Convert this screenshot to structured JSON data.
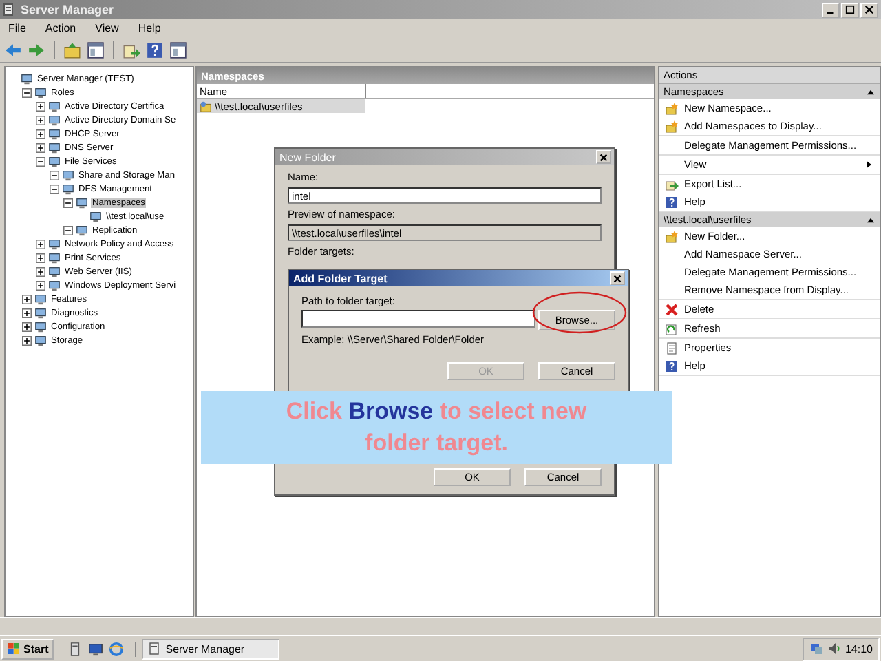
{
  "window": {
    "title": "Server Manager"
  },
  "menu": [
    "File",
    "Action",
    "View",
    "Help"
  ],
  "toolbar": [
    {
      "kind": "back"
    },
    {
      "kind": "forward"
    },
    {
      "kind": "up"
    },
    {
      "kind": "pane"
    },
    {
      "kind": "export"
    },
    {
      "kind": "help"
    },
    {
      "kind": "pane"
    }
  ],
  "tree": [
    {
      "label": "Server Manager (TEST)",
      "selected": false,
      "children": [
        {
          "label": "Roles",
          "selected": false,
          "expanded": true,
          "children": [
            {
              "label": "Active Directory Certifica",
              "selected": false,
              "expanded": false
            },
            {
              "label": "Active Directory Domain Se",
              "selected": false,
              "expanded": false
            },
            {
              "label": "DHCP Server",
              "selected": false,
              "expanded": false
            },
            {
              "label": "DNS Server",
              "selected": false,
              "expanded": false
            },
            {
              "label": "File Services",
              "selected": false,
              "expanded": true,
              "children": [
                {
                  "label": "Share and Storage Man",
                  "selected": false,
                  "expanded": true
                },
                {
                  "label": "DFS Management",
                  "selected": false,
                  "expanded": true,
                  "children": [
                    {
                      "label": "Namespaces",
                      "selected": true,
                      "expanded": true,
                      "children": [
                        {
                          "label": "\\\\test.local\\use",
                          "selected": false
                        }
                      ]
                    },
                    {
                      "label": "Replication",
                      "selected": false,
                      "expanded": true
                    }
                  ]
                }
              ]
            },
            {
              "label": "Network Policy and Access",
              "selected": false,
              "expanded": false
            },
            {
              "label": "Print Services",
              "selected": false,
              "expanded": false
            },
            {
              "label": "Web Server (IIS)",
              "selected": false,
              "expanded": false
            },
            {
              "label": "Windows Deployment Servi",
              "selected": false,
              "expanded": false
            }
          ]
        },
        {
          "label": "Features",
          "selected": false,
          "expanded": false
        },
        {
          "label": "Diagnostics",
          "selected": false,
          "expanded": false
        },
        {
          "label": "Configuration",
          "selected": false,
          "expanded": false
        },
        {
          "label": "Storage",
          "selected": false,
          "expanded": false
        }
      ]
    }
  ],
  "list": {
    "title": "Namespaces",
    "columns": [
      "Name"
    ],
    "rows": [
      {
        "name": "\\\\test.local\\userfiles",
        "selected": true
      }
    ]
  },
  "new_folder": {
    "title": "New Folder",
    "name_label": "Name:",
    "name_value": "intel",
    "preview_label": "Preview of namespace:",
    "preview_value": "\\\\test.local\\userfiles\\intel",
    "targets_label": "Folder targets:",
    "buttons": [
      "OK",
      "Cancel"
    ]
  },
  "add_target": {
    "title": "Add Folder Target",
    "path_label": "Path to folder target:",
    "browse": "Browse...",
    "example": "Example: \\\\Server\\Shared Folder\\Folder",
    "buttons": [
      {
        "label": "OK",
        "disabled": true
      },
      {
        "label": "Cancel",
        "disabled": false
      }
    ]
  },
  "callout": [
    {
      "text": "Click ",
      "highlight": false
    },
    {
      "text": "Browse",
      "highlight": true
    },
    {
      "text": " to select new folder target.",
      "highlight": false
    }
  ],
  "actions": {
    "title": "Actions",
    "sections": [
      {
        "title": "Namespaces",
        "groups": [
          [
            {
              "label": "New Namespace...",
              "kind": "star"
            },
            {
              "label": "Add Namespaces to Display...",
              "kind": "star"
            }
          ],
          [
            {
              "label": "Delegate Management Permissions..."
            }
          ],
          [
            {
              "label": "View",
              "submenu": true
            }
          ],
          [
            {
              "label": "Export List...",
              "kind": "export"
            },
            {
              "label": "Help",
              "kind": "help"
            }
          ]
        ]
      },
      {
        "title": "\\\\test.local\\userfiles",
        "groups": [
          [
            {
              "label": "New Folder...",
              "kind": "star"
            },
            {
              "label": "Add Namespace Server..."
            },
            {
              "label": "Delegate Management Permissions..."
            },
            {
              "label": "Remove Namespace from Display..."
            }
          ],
          [
            {
              "label": "Delete",
              "kind": "delete"
            }
          ],
          [
            {
              "label": "Refresh",
              "kind": "refresh"
            }
          ],
          [
            {
              "label": "Properties",
              "kind": "properties"
            },
            {
              "label": "Help",
              "kind": "help"
            }
          ]
        ]
      }
    ]
  },
  "taskbar": {
    "start": "Start",
    "quick_launch": [
      {
        "kind": "server"
      },
      {
        "kind": "desktop"
      },
      {
        "kind": "browser"
      }
    ],
    "tasks": [
      {
        "label": "Server Manager",
        "selected": true
      }
    ],
    "clock": "14:10"
  }
}
